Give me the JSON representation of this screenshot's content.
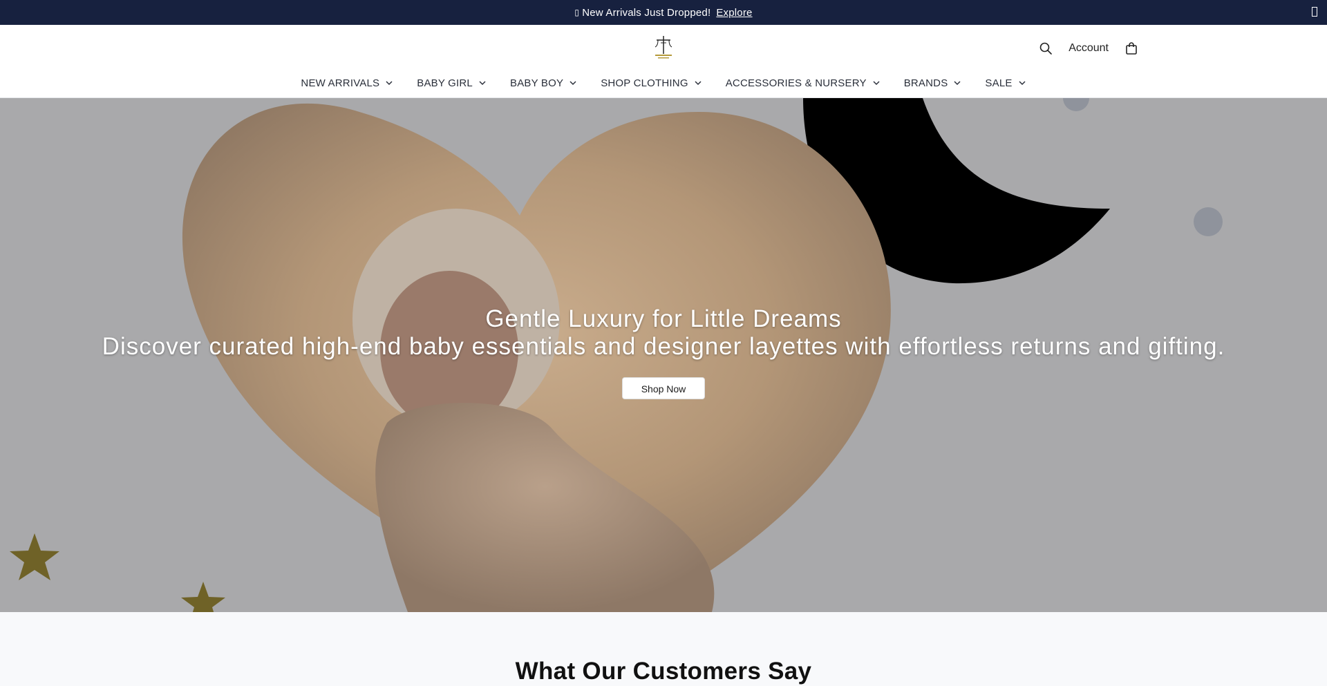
{
  "announcement": {
    "glyph": "▯",
    "message": "New Arrivals Just Dropped!",
    "link_label": "Explore",
    "bg_color": "#17213f"
  },
  "header": {
    "logo_icon": "boutique-logo-icon",
    "actions": {
      "search_icon": "search-icon",
      "account_label": "Account",
      "cart_icon": "shopping-bag-icon"
    }
  },
  "nav": {
    "items": [
      {
        "label": "NEW ARRIVALS"
      },
      {
        "label": "BABY GIRL"
      },
      {
        "label": "BABY BOY"
      },
      {
        "label": "SHOP CLOTHING"
      },
      {
        "label": "ACCESSORIES & NURSERY"
      },
      {
        "label": "BRANDS"
      },
      {
        "label": "SALE"
      }
    ]
  },
  "hero": {
    "title": "Gentle Luxury for Little Dreams",
    "subtitle": "Discover curated high-end baby essentials and designer layettes with effortless returns and gifting.",
    "button_label": "Shop Now"
  },
  "testimonials": {
    "heading": "What Our Customers Say"
  }
}
